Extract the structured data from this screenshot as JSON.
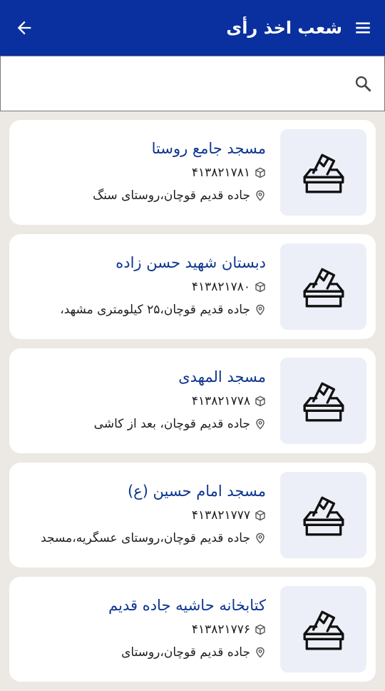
{
  "header": {
    "title": "شعب اخذ رأی",
    "back_icon": "arrow-left-icon",
    "menu_icon": "hamburger-menu-icon",
    "background": "#0a2f9e"
  },
  "search": {
    "value": "",
    "placeholder": "",
    "icon": "search-icon"
  },
  "stations": [
    {
      "name": "مسجد جامع روستا",
      "code": "۴۱۳۸۲۱۷۸۱",
      "address": "جاده قدیم قوچان،روستای سنگ"
    },
    {
      "name": "دبستان شهید حسن زاده",
      "code": "۴۱۳۸۲۱۷۸۰",
      "address": "جاده قدیم قوچان،۲۵ کیلومتری مشهد،"
    },
    {
      "name": "مسجد المهدی",
      "code": "۴۱۳۸۲۱۷۷۸",
      "address": "جاده قدیم قوچان، بعد از کاشی"
    },
    {
      "name": "مسجد امام حسین (ع)",
      "code": "۴۱۳۸۲۱۷۷۷",
      "address": "جاده قدیم قوچان،روستای عسگریه،مسجد"
    },
    {
      "name": "کتابخانه حاشیه جاده قدیم",
      "code": "۴۱۳۸۲۱۷۷۶",
      "address": "جاده قدیم قوچان،روستای"
    }
  ],
  "icons": {
    "thumbnail": "ballot-box-icon",
    "code": "cube-icon",
    "address": "location-pin-icon"
  },
  "colors": {
    "accent": "#0d3590",
    "thumb_bg": "#eceff7"
  }
}
